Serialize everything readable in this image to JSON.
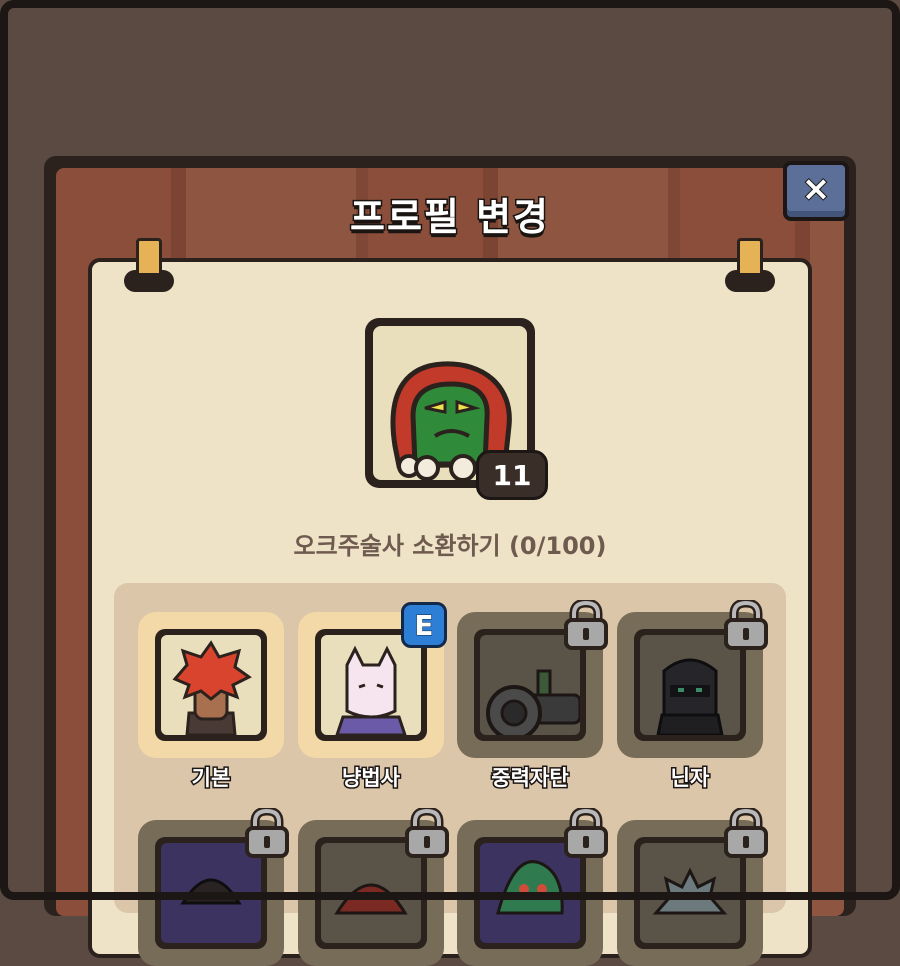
{
  "dialog": {
    "title": "프로필 변경",
    "close_label": "×"
  },
  "current_profile": {
    "icon": "orc-shaman-icon",
    "level": "11",
    "summon_progress_text": "오크주술사 소환하기 (0/100)"
  },
  "profiles": [
    {
      "label": "기본",
      "icon": "red-hair-hero-icon",
      "locked": false,
      "equipped": false
    },
    {
      "label": "냥법사",
      "icon": "cat-wizard-icon",
      "locked": false,
      "equipped": true,
      "equipped_badge": "E"
    },
    {
      "label": "중력자탄",
      "icon": "gravity-cannon-icon",
      "locked": true
    },
    {
      "label": "닌자",
      "icon": "ninja-icon",
      "locked": true
    },
    {
      "label": "",
      "icon": "masked-fighter-icon",
      "locked": true
    },
    {
      "label": "",
      "icon": "red-hood-icon",
      "locked": true
    },
    {
      "label": "",
      "icon": "green-monster-icon",
      "locked": true
    },
    {
      "label": "",
      "icon": "spiky-hair-icon",
      "locked": true
    }
  ],
  "colors": {
    "background": "#5a4a42",
    "paper": "#eee3c7",
    "close_button": "#5b6f99",
    "equipped_badge": "#2c7fd4",
    "unlocked_card": "#f2d9a7",
    "locked_card": "#776c57"
  }
}
